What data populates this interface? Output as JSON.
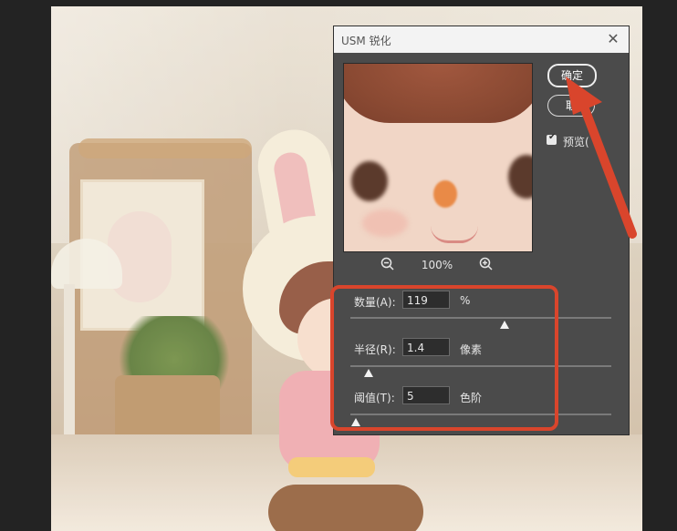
{
  "dialog": {
    "title": "USM 锐化",
    "close_symbol": "✕",
    "ok_label": "确定",
    "cancel_label": "取",
    "preview_label": "预览(",
    "preview_checked": true,
    "zoom_value": "100%",
    "params": [
      {
        "label": "数量(A):",
        "value": "119",
        "unit": "%",
        "slider_fraction": 0.59
      },
      {
        "label": "半径(R):",
        "value": "1.4",
        "unit": "像素",
        "slider_fraction": 0.07
      },
      {
        "label": "阈值(T):",
        "value": "5",
        "unit": "色阶",
        "slider_fraction": 0.02
      }
    ]
  },
  "annotation": {
    "highlight_color": "#d9452c"
  }
}
